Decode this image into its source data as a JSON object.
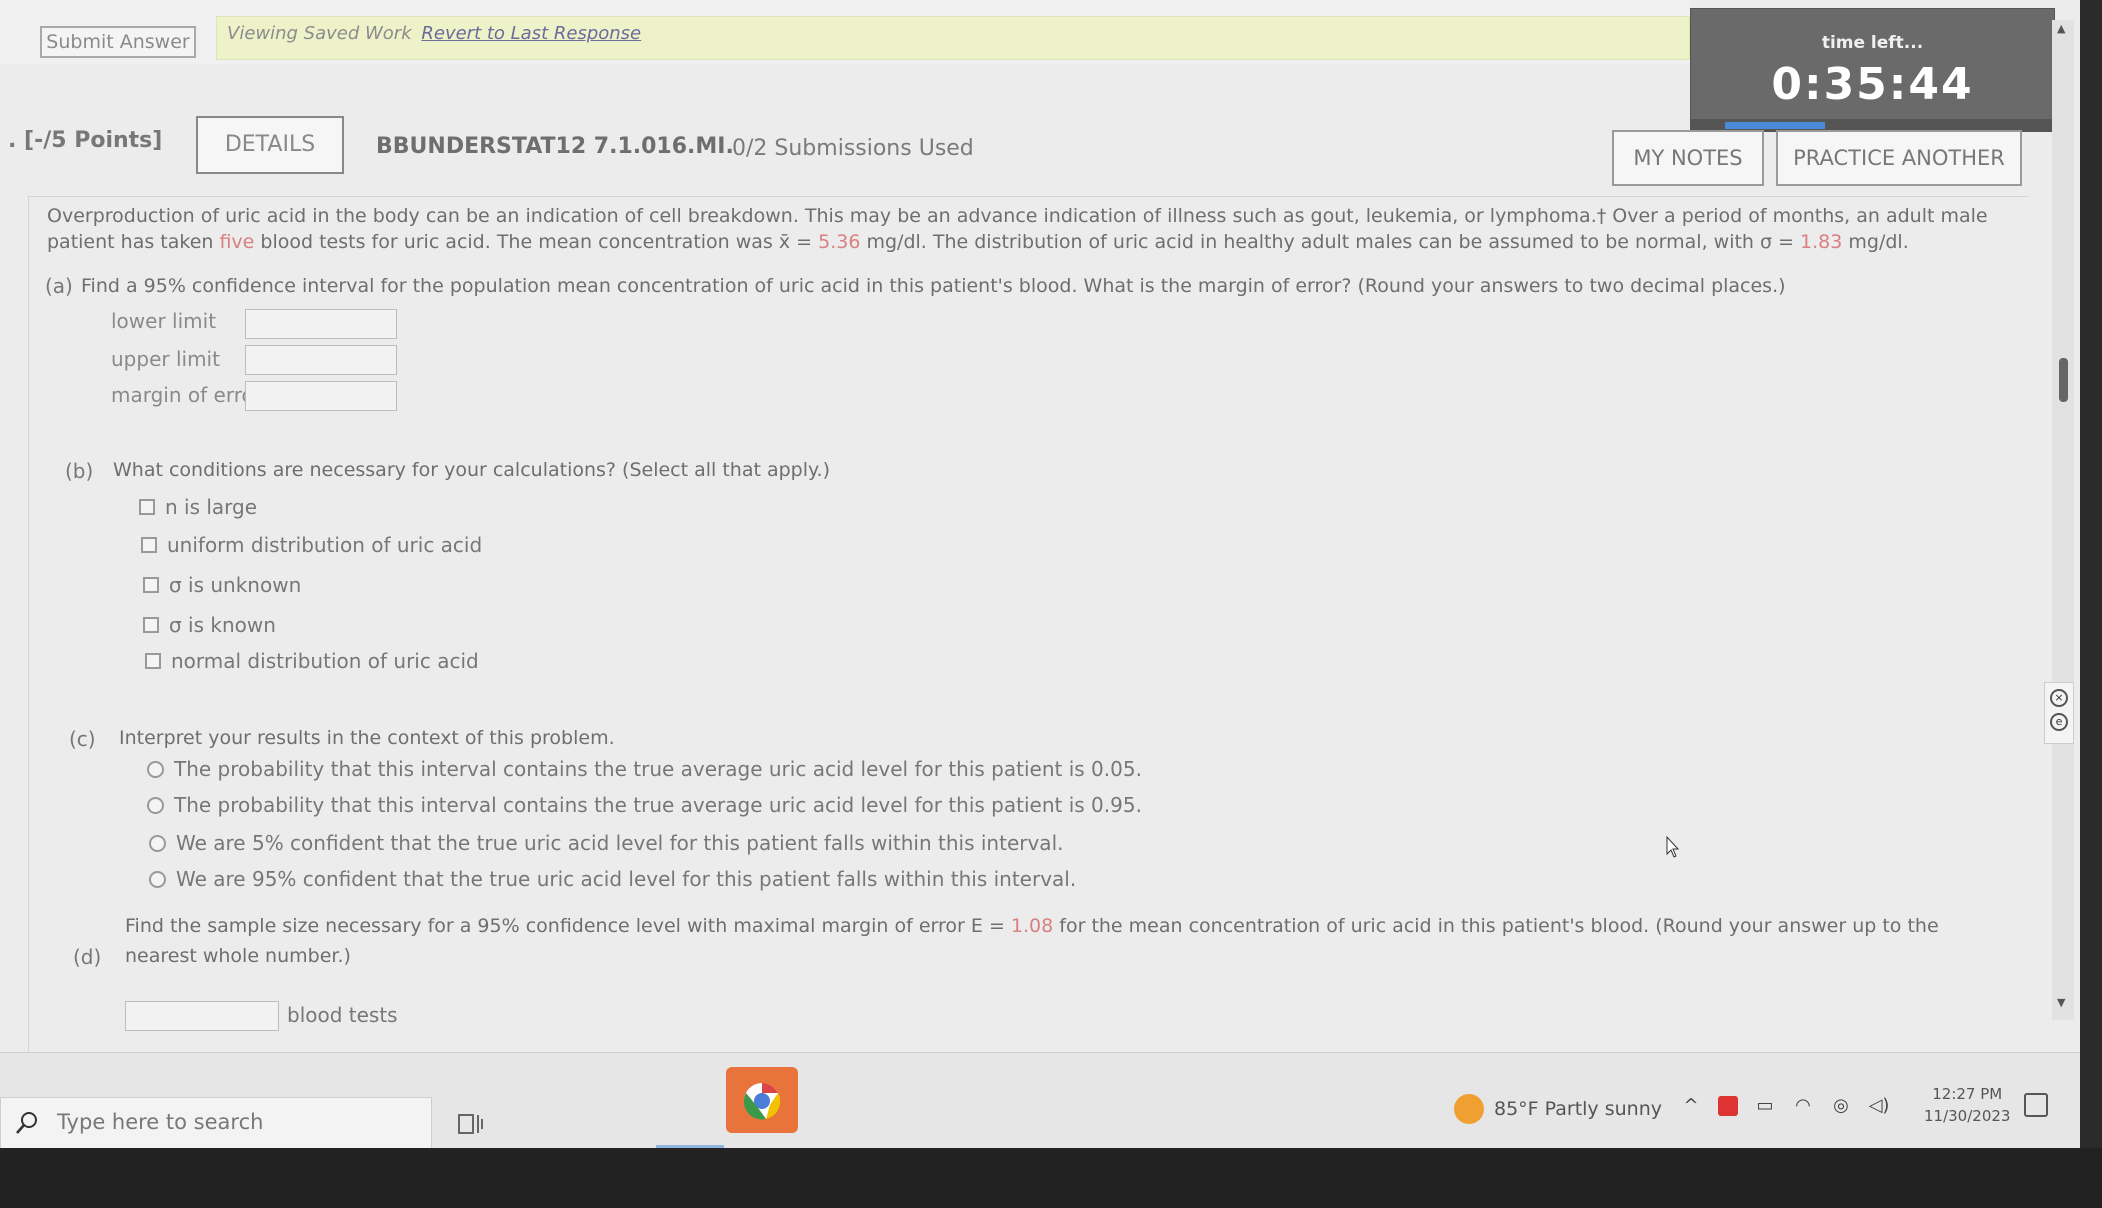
{
  "topbar": {
    "submit_label": "Submit Answer",
    "banner_text": "Viewing Saved Work",
    "banner_link": "Revert to Last Response"
  },
  "timer": {
    "label": "time left...",
    "value": "0:35:44"
  },
  "header": {
    "points": ". [-/5 Points]",
    "details_label": "DETAILS",
    "question_id": "BBUNDERSTAT12 7.1.016.MI.",
    "submissions": "0/2 Submissions Used",
    "my_notes_label": "MY NOTES",
    "practice_label": "PRACTICE ANOTHER"
  },
  "intro": {
    "t1": "Overproduction of uric acid in the body can be an indication of cell breakdown. This may be an advance indication of illness such as gout, leukemia, or lymphoma.† Over a period of months, an adult male patient has taken ",
    "five": "five",
    "t2": " blood tests for uric acid. The mean concentration was ",
    "xbar": "x̄ = ",
    "mean_value": "5.36",
    "t3": " mg/dl. The distribution of uric acid in healthy adult males can be assumed to be normal, with σ = ",
    "sigma_value": "1.83",
    "t4": " mg/dl."
  },
  "part_a": {
    "label": "(a)",
    "text": "Find a 95% confidence interval for the population mean concentration of uric acid in this patient's blood. What is the margin of error? (Round your answers to two decimal places.)",
    "fields": [
      "lower limit",
      "upper limit",
      "margin of error"
    ]
  },
  "part_b": {
    "label": "(b)",
    "text": "What conditions are necessary for your calculations? (Select all that apply.)",
    "options": [
      "n is large",
      "uniform distribution of uric acid",
      "σ is unknown",
      "σ is known",
      "normal distribution of uric acid"
    ]
  },
  "part_c": {
    "label": "(c)",
    "text": "Interpret your results in the context of this problem.",
    "options": [
      "The probability that this interval contains the true average uric acid level for this patient is 0.05.",
      "The probability that this interval contains the true average uric acid level for this patient is 0.95.",
      "We are 5% confident that the true uric acid level for this patient falls within this interval.",
      "We are 95% confident that the true uric acid level for this patient falls within this interval."
    ]
  },
  "part_d": {
    "label": "(d)",
    "t1": "Find the sample size necessary for a 95% confidence level with maximal margin of error E = ",
    "e_value": "1.08",
    "t2": " for the mean concentration of uric acid in this patient's blood. (Round your answer up to the nearest whole number.)",
    "unit": "blood tests"
  },
  "taskbar": {
    "search_placeholder": "Type here to search",
    "weather": "85°F  Partly sunny",
    "time": "12:27 PM",
    "date": "11/30/2023"
  },
  "icons": {
    "search": "search-icon",
    "chrome": "chrome-icon",
    "weather": "weather-icon"
  }
}
